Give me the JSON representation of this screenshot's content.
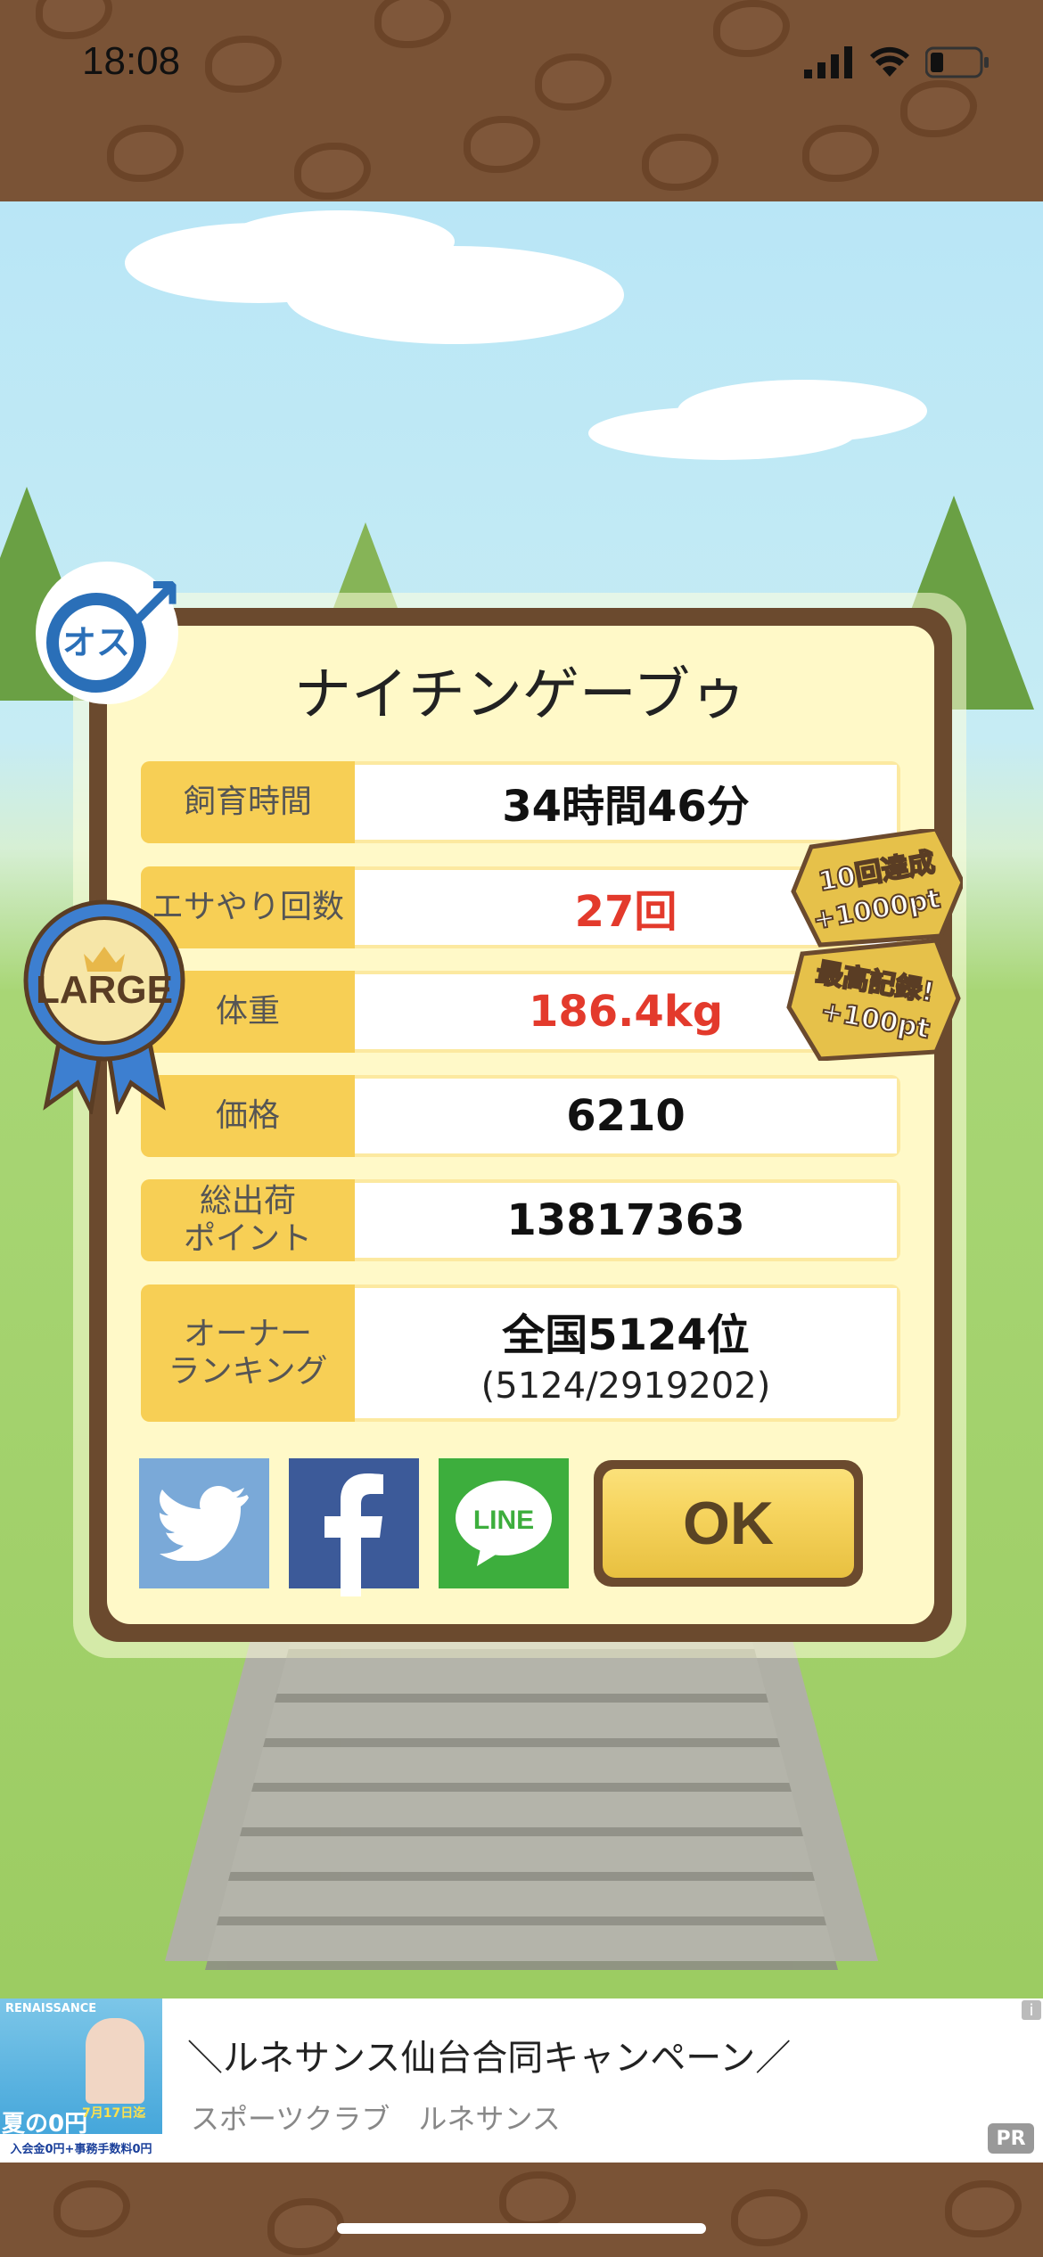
{
  "status_bar": {
    "time": "18:08"
  },
  "dialog": {
    "title": "ナイチンゲーブゥ",
    "gender_badge": "オス",
    "size_badge": "LARGE",
    "bonus_badges": [
      {
        "line1": "10回達成",
        "line2": "+1000pt"
      },
      {
        "line1": "最高記録!",
        "line2": "+100pt"
      }
    ],
    "stats": [
      {
        "label": "飼育時間",
        "value": "34時間46分",
        "highlight": false
      },
      {
        "label": "エサやり回数",
        "value": "27回",
        "highlight": true
      },
      {
        "label": "体重",
        "value": "186.4kg",
        "highlight": true
      },
      {
        "label": "価格",
        "value": "6210",
        "highlight": false
      },
      {
        "label": "総出荷\nポイント",
        "value": "13817363",
        "highlight": false
      },
      {
        "label": "オーナー\nランキング",
        "value": "全国5124位",
        "sub_value": "(5124/2919202)",
        "highlight": false
      }
    ],
    "share": {
      "line_label": "LINE"
    },
    "ok_label": "OK"
  },
  "ad": {
    "title": "＼ルネサンス仙台合同キャンペーン／",
    "subtitle": "スポーツクラブ　ルネサンス",
    "pr_label": "PR",
    "info_label": "i",
    "image_text": {
      "brand": "RENAISSANCE",
      "headline": "夏の0円",
      "sub": "7月17日迄",
      "bottom": "入会金0円+事務手数料0円"
    }
  },
  "colors": {
    "label_bg": "#f7cf55",
    "highlight_value": "#e33a2c",
    "frame": "#6b4a2e",
    "panel": "#fff9c8"
  }
}
